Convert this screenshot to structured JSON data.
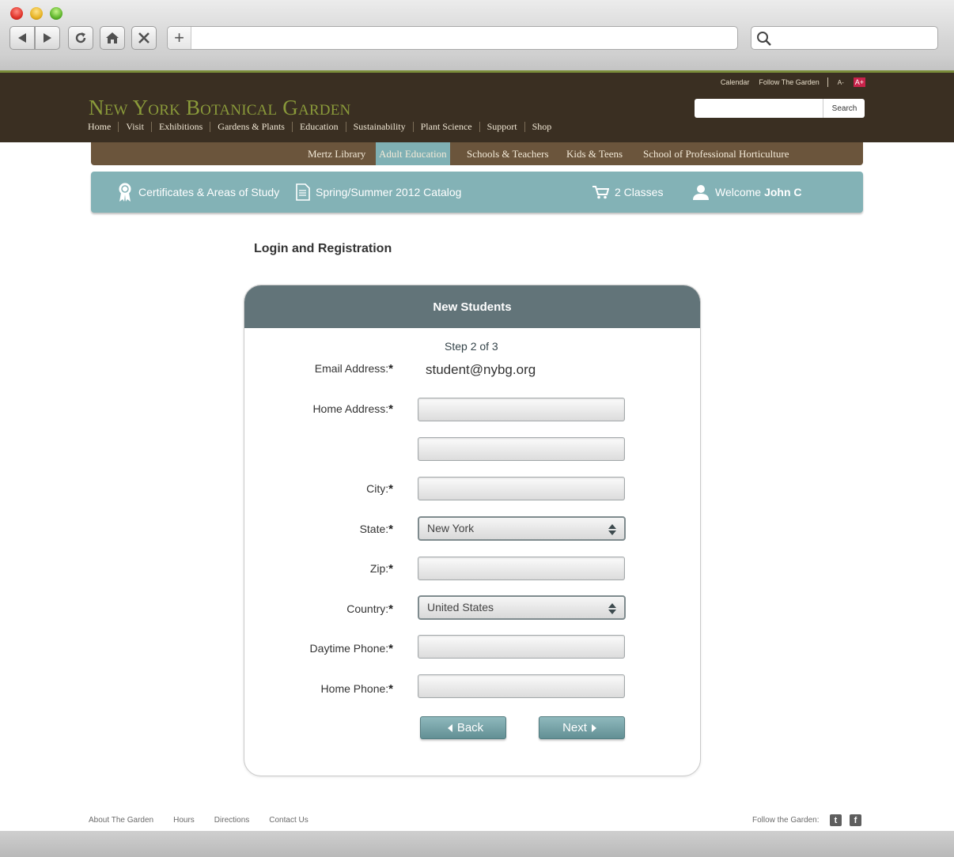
{
  "site": {
    "logo": "New York Botanical Garden",
    "utility_links": [
      "Calendar",
      "Follow The Garden"
    ],
    "font_small": "A-",
    "font_large": "A+",
    "search_button": "Search",
    "main_nav": [
      "Home",
      "Visit",
      "Exhibitions",
      "Gardens & Plants",
      "Education",
      "Sustainability",
      "Plant Science",
      "Support",
      "Shop"
    ],
    "sub_nav": [
      "Mertz Library",
      "Adult Education",
      "Schools & Teachers",
      "Kids & Teens",
      "School of Professional Horticulture"
    ],
    "sub_nav_active": "Adult Education"
  },
  "toolbar": {
    "certificates": "Certificates & Areas of Study",
    "catalog": "Spring/Summer 2012 Catalog",
    "cart": "2 Classes",
    "welcome_prefix": "Welcome",
    "welcome_name": "John C"
  },
  "page": {
    "title": "Login and Registration"
  },
  "form": {
    "header": "New Students",
    "step": "Step 2 of 3",
    "email_label": "Email Address:",
    "email_value": "student@nybg.org",
    "home_address_label": "Home Address:",
    "city_label": "City:",
    "state_label": "State:",
    "state_value": "New York",
    "zip_label": "Zip:",
    "country_label": "Country:",
    "country_value": "United States",
    "daytime_phone_label": "Daytime Phone:",
    "home_phone_label": "Home Phone:",
    "required_mark": "*",
    "back_label": "Back",
    "next_label": "Next"
  },
  "footer": {
    "links": [
      "About The Garden",
      "Hours",
      "Directions",
      "Contact Us"
    ],
    "follow": "Follow the Garden:",
    "twitter": "t",
    "facebook": "f"
  },
  "colors": {
    "header_brown": "#3a2f22",
    "subnav_brown": "#6b553c",
    "teal": "#83b2b6",
    "card_header": "#627479",
    "logo_green": "#8a9a3a",
    "accent_pink": "#c8234a"
  }
}
